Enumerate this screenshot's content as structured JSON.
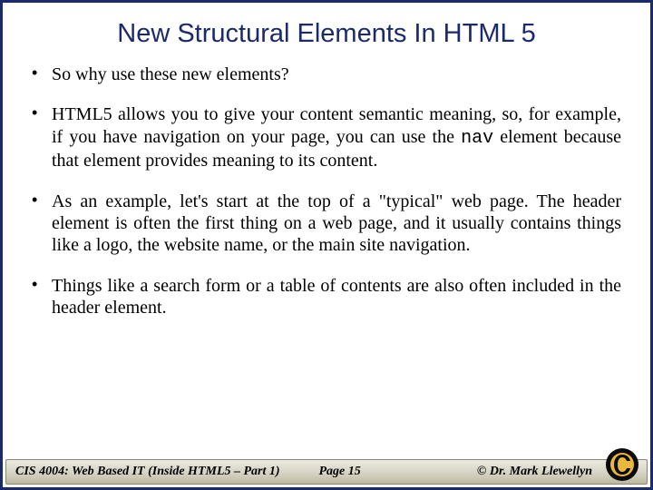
{
  "title": "New Structural Elements In HTML 5",
  "bullets": {
    "b1": "So why use these new elements?",
    "b2a": "HTML5 allows you to give your content semantic meaning, so, for example, if you have navigation on your page, you can use the ",
    "b2code": "nav",
    "b2b": " element because that element provides meaning to its content.",
    "b3": " As an example, let's start at the top of a \"typical\" web page. The header element is often the first thing on a web page, and it usually contains things like a logo, the website name, or the main site navigation.",
    "b4": "Things like a search form or a table of contents are also often included in the header element."
  },
  "footer": {
    "left": "CIS 4004: Web Based IT (Inside HTML5 – Part 1)",
    "center": "Page 15",
    "right": "© Dr. Mark Llewellyn"
  }
}
